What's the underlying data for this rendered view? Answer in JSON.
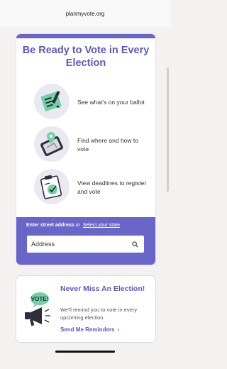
{
  "browser": {
    "url": "planmyvote.org"
  },
  "card": {
    "title": "Be Ready to Vote in Every Election",
    "features": [
      {
        "icon": "ballot-icon",
        "label": "See what's on your ballot"
      },
      {
        "icon": "map-phone-icon",
        "label": "Find where and how to vote"
      },
      {
        "icon": "clipboard-check-icon",
        "label": "View deadlines to register and vote"
      }
    ]
  },
  "address": {
    "caption_strong": "Enter street address",
    "caption_or": "or",
    "select_state_link": "Select your state",
    "placeholder": "Address",
    "search_icon": "search-icon"
  },
  "reminder": {
    "illustration_text": "VOTE!",
    "title": "Never Miss An Election!",
    "body": "We'll remind you to vote in every upcoming election.",
    "link": "Send Me Reminders",
    "link_chevron": "›"
  },
  "colors": {
    "accent": "#6a66c9",
    "title": "#5b57c4",
    "mint": "#6fd1a6"
  }
}
